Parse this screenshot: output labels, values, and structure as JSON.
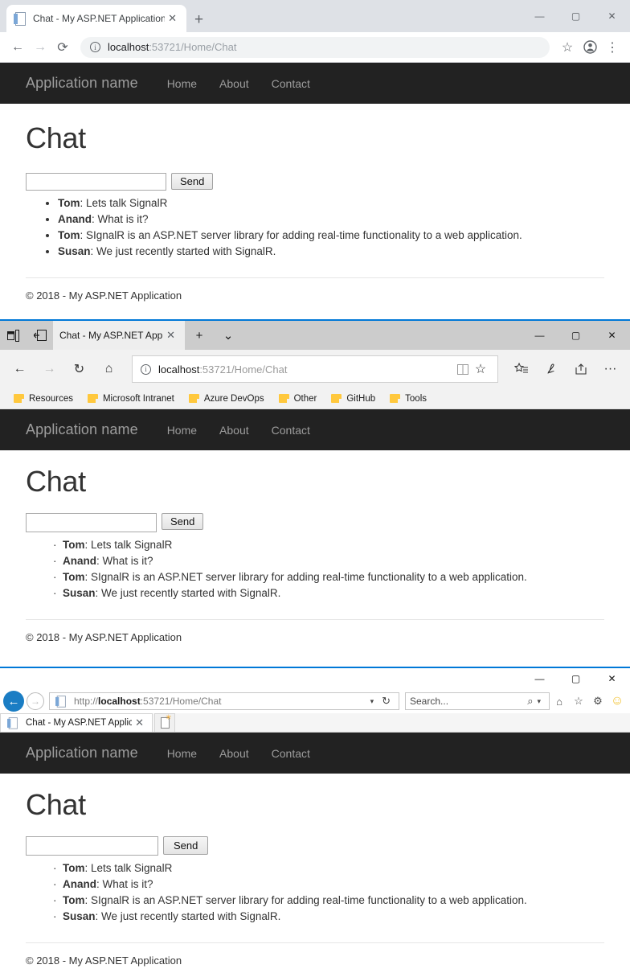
{
  "site": {
    "brand": "Application name",
    "nav": [
      "Home",
      "About",
      "Contact"
    ],
    "page_title": "Chat",
    "input_value": "",
    "send_label": "Send",
    "messages": [
      {
        "user": "Tom",
        "sep": ": ",
        "text": "Lets talk SignalR"
      },
      {
        "user": "Anand",
        "sep": ": ",
        "text": "What is it?"
      },
      {
        "user": "Tom",
        "sep": ": ",
        "text": "SIgnalR is an ASP.NET server library for adding real-time functionality to a web application."
      },
      {
        "user": "Susan",
        "sep": ": ",
        "text": "We just recently started with SignalR."
      }
    ],
    "footer": "© 2018 - My ASP.NET Application"
  },
  "chrome": {
    "tab_title": "Chat - My ASP.NET Application",
    "tab_close": "✕",
    "new_tab": "+",
    "back": "←",
    "forward": "→",
    "reload": "⟳",
    "url_host": "localhost",
    "url_path": ":53721/Home/Chat",
    "info_glyph": "i",
    "star": "☆",
    "profile": "●",
    "menu": "⋮",
    "win_min": "—",
    "win_max": "▢",
    "win_close": "✕"
  },
  "edge": {
    "tab_preview_icon": "▤",
    "set_aside_icon": "⇤",
    "tab_title": "Chat - My ASP.NET App",
    "tab_close": "✕",
    "new_tab": "+",
    "tab_menu": "⌄",
    "back": "←",
    "forward": "→",
    "reload": "↻",
    "home": "⌂",
    "info_glyph": "i",
    "url_host": "localhost",
    "url_path": ":53721/Home/Chat",
    "reading_view": "▯",
    "star": "☆",
    "favorites_hub": "☆≡",
    "web_note": "✎",
    "share": "↗",
    "more": "···",
    "win_min": "—",
    "win_max": "▢",
    "win_close": "✕",
    "favorites": [
      "Resources",
      "Microsoft Intranet",
      "Azure DevOps",
      "Other",
      "GitHub",
      "Tools"
    ]
  },
  "ie": {
    "back": "←",
    "forward": "→",
    "url_scheme": "http://",
    "url_host": "localhost",
    "url_path": ":53721/Home/Chat",
    "addr_caret": "▾",
    "refresh": "↻",
    "search_placeholder": "Search...",
    "search_icon": "⌕",
    "search_caret": "▾",
    "home": "⌂",
    "favorites": "☆",
    "settings": "⚙",
    "smiley": "☺",
    "tab_title": "Chat - My ASP.NET Applica...",
    "tab_close": "✕",
    "win_min": "—",
    "win_max": "▢",
    "win_close": "✕"
  }
}
